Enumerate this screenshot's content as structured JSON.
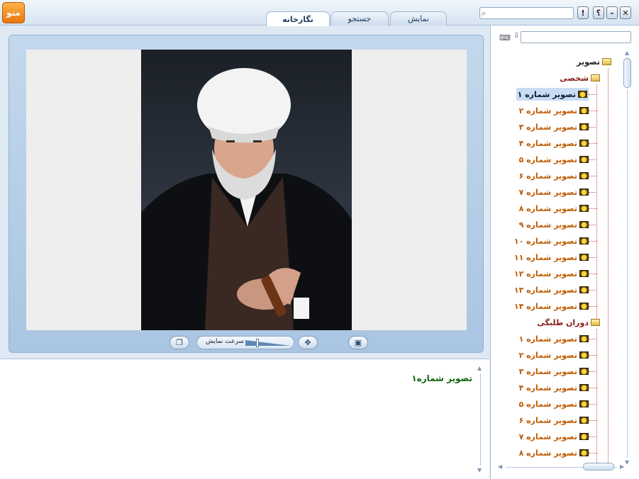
{
  "menu_label": "منو",
  "tabs": [
    {
      "label": "نگارخانه",
      "active": true
    },
    {
      "label": "جستجو",
      "active": false
    },
    {
      "label": "نمایش",
      "active": false
    }
  ],
  "window_buttons": {
    "help": "؟",
    "info": "!",
    "minimize": "–",
    "close": "✕"
  },
  "viewer": {
    "current_caption": "تصویر شماره۱",
    "speed_label": "سرعت نمایش",
    "speed_level": 0.25
  },
  "tree": {
    "root": "تصویر",
    "groups": [
      {
        "label": "شخصی",
        "items": [
          "تصویر شماره ۱",
          "تصویر شماره ۲",
          "تصویر شماره ۳",
          "تصویر شماره ۴",
          "تصویر شماره ۵",
          "تصویر شماره ۶",
          "تصویر شماره ۷",
          "تصویر شماره ۸",
          "تصویر شماره ۹",
          "تصویر شماره ۱۰",
          "تصویر شماره ۱۱",
          "تصویر شماره ۱۲",
          "تصویر شماره ۱۳",
          "تصویر شماره ۱۴"
        ]
      },
      {
        "label": "دوران طلبگی",
        "items": [
          "تصویر شماره ۱",
          "تصویر شماره ۲",
          "تصویر شماره ۳",
          "تصویر شماره ۴",
          "تصویر شماره ۵",
          "تصویر شماره ۶",
          "تصویر شماره ۷",
          "تصویر شماره ۸"
        ]
      }
    ],
    "selected": "تصویر شماره ۱"
  },
  "colors": {
    "accent": "#e8760c",
    "caption_text": "#116611",
    "tree_leaf": "#c05a00",
    "tree_group": "#8a1b1b"
  }
}
